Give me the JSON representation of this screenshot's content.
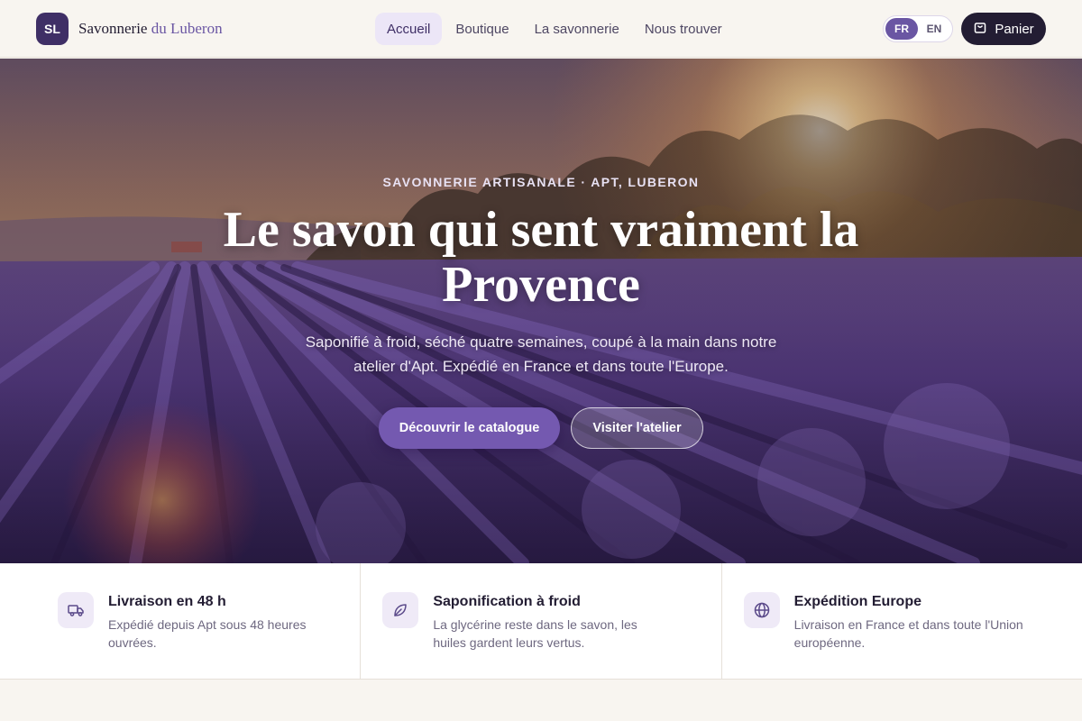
{
  "brand": {
    "logo": "SL",
    "name_part1": "Savonnerie",
    "name_part2": "du Luberon"
  },
  "nav": {
    "items": [
      {
        "label": "Accueil",
        "active": true
      },
      {
        "label": "Boutique",
        "active": false
      },
      {
        "label": "La savonnerie",
        "active": false
      },
      {
        "label": "Nous trouver",
        "active": false
      }
    ]
  },
  "lang": {
    "options": [
      "FR",
      "EN"
    ],
    "selected": "FR"
  },
  "cart": {
    "label": "Panier",
    "icon": "shopping-bag-icon"
  },
  "hero": {
    "eyebrow": "SAVONNERIE ARTISANALE · APT, LUBERON",
    "headline": "Le savon qui sent vraiment la Provence",
    "subtitle": "Saponifié à froid, séché quatre semaines, coupé à la main dans notre atelier d'Apt. Expédié en France et dans toute l'Europe.",
    "primary_cta": "Découvrir le catalogue",
    "secondary_cta": "Visiter l'atelier"
  },
  "features": [
    {
      "icon": "truck-icon",
      "title": "Livraison en 48 h",
      "desc": "Expédié depuis Apt sous 48 heures ouvrées."
    },
    {
      "icon": "leaf-icon",
      "title": "Saponification à froid",
      "desc": "La glycérine reste dans le savon, les huiles gardent leurs vertus."
    },
    {
      "icon": "globe-icon",
      "title": "Expédition Europe",
      "desc": "Livraison en France et dans toute l'Union européenne."
    }
  ],
  "colors": {
    "accent": "#6a56a3",
    "dark": "#231d33",
    "cream": "#f8f5f0",
    "lavender": "#7459b0"
  }
}
